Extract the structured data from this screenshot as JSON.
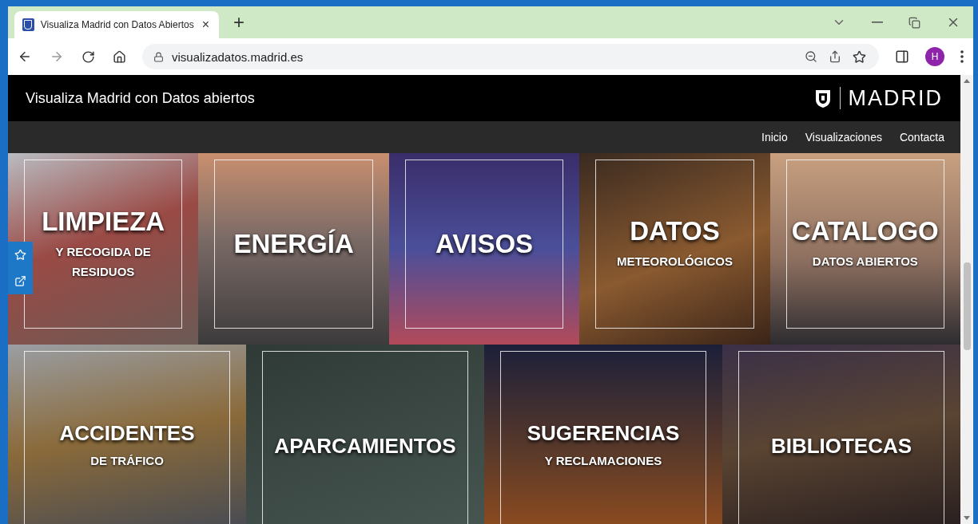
{
  "browser": {
    "tab_title": "Visualiza Madrid con Datos Abiertos",
    "close_tab": "×",
    "new_tab": "+",
    "address": "visualizadatos.madrid.es",
    "profile_initial": "H"
  },
  "site": {
    "title": "Visualiza Madrid con Datos abiertos",
    "logo_text": "MADRID",
    "nav": [
      {
        "label": "Inicio"
      },
      {
        "label": "Visualizaciones"
      },
      {
        "label": "Contacta"
      }
    ]
  },
  "tile_rows": [
    {
      "tiles": [
        {
          "title": "LIMPIEZA",
          "subtitle": "Y RECOGIDA DE RESIDUOS"
        },
        {
          "title": "ENERGÍA"
        },
        {
          "title": "AVISOS"
        },
        {
          "title": "DATOS",
          "subtitle": "METEOROLÓGICOS"
        },
        {
          "title": "CATALOGO",
          "subtitle": "DATOS ABIERTOS"
        }
      ]
    },
    {
      "tiles": [
        {
          "title": "ACCIDENTES",
          "subtitle": "DE TRÁFICO"
        },
        {
          "title": "APARCAMIENTOS"
        },
        {
          "title": "SUGERENCIAS",
          "subtitle": "Y RECLAMACIONES"
        },
        {
          "title": "BIBLIOTECAS"
        }
      ]
    }
  ]
}
